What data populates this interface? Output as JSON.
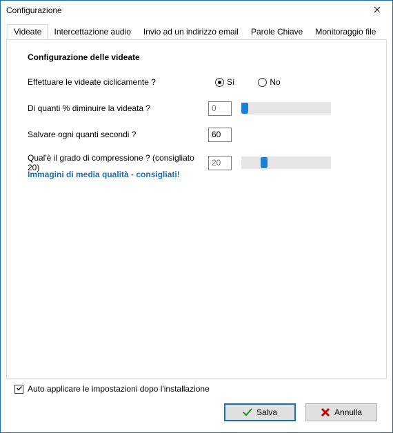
{
  "window": {
    "title": "Configurazione"
  },
  "tabs": {
    "items": [
      {
        "label": "Videate"
      },
      {
        "label": "Intercettazione audio"
      },
      {
        "label": "Invio ad un indirizzo email"
      },
      {
        "label": "Parole Chiave"
      },
      {
        "label": "Monitoraggio file"
      }
    ],
    "active_index": 0
  },
  "videate": {
    "section_title": "Configurazione delle videate",
    "cyclic_label": "Effettuare le videate ciclicamente ?",
    "cyclic_yes": "Sì",
    "cyclic_no": "No",
    "cyclic_value": true,
    "reduce_label": "Di quanti % diminuire la videata ?",
    "reduce_value": "0",
    "interval_label": "Salvare ogni quanti secondi ?",
    "interval_value": "60",
    "compression_label": "Qual'è il grado di compressione ? (consigliato 20)",
    "compression_value": "20",
    "compression_hint": "Immagini di media qualità - consigliati!"
  },
  "footer": {
    "auto_apply_label": "Auto applicare le impostazioni dopo l'installazione",
    "auto_apply_checked": true,
    "save_label": "Salva",
    "cancel_label": "Annulla"
  }
}
